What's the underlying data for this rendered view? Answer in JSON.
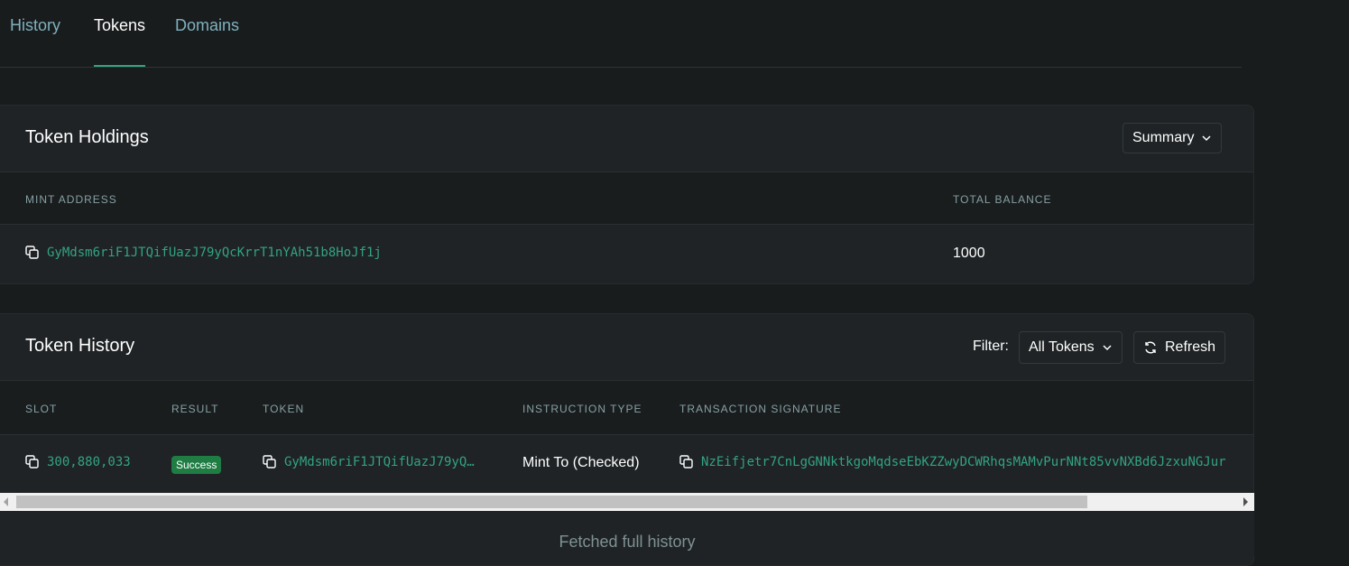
{
  "tabs": [
    {
      "label": "History"
    },
    {
      "label": "Tokens"
    },
    {
      "label": "Domains"
    }
  ],
  "holdings": {
    "title": "Token Holdings",
    "view_select": "Summary",
    "columns": {
      "mint": "MINT ADDRESS",
      "balance": "TOTAL BALANCE"
    },
    "rows": [
      {
        "mint": "GyMdsm6riF1JTQifUazJ79yQcKrrT1nYAh51b8HoJf1j",
        "balance": "1000"
      }
    ]
  },
  "history": {
    "title": "Token History",
    "filter_label": "Filter:",
    "filter_value": "All Tokens",
    "refresh_label": "Refresh",
    "columns": {
      "slot": "SLOT",
      "result": "RESULT",
      "token": "TOKEN",
      "instruction": "INSTRUCTION TYPE",
      "signature": "TRANSACTION SIGNATURE"
    },
    "rows": [
      {
        "slot": "300,880,033",
        "result": "Success",
        "token": "GyMdsm6riF1JTQifUazJ79yQ…",
        "instruction": "Mint To (Checked)",
        "signature": "NzEifjetr7CnLgGNNktkgoMqdseEbKZZwyDCWRhqsMAMvPurNNt85vvNXBd6JzxuNGJur"
      }
    ],
    "footer": "Fetched full history"
  },
  "colors": {
    "background": "#191c1d",
    "card": "#1f2325",
    "accent": "#33a382",
    "success": "#1f7d44"
  },
  "icons": [
    "copy-icon",
    "chevron-down-icon",
    "refresh-icon"
  ]
}
